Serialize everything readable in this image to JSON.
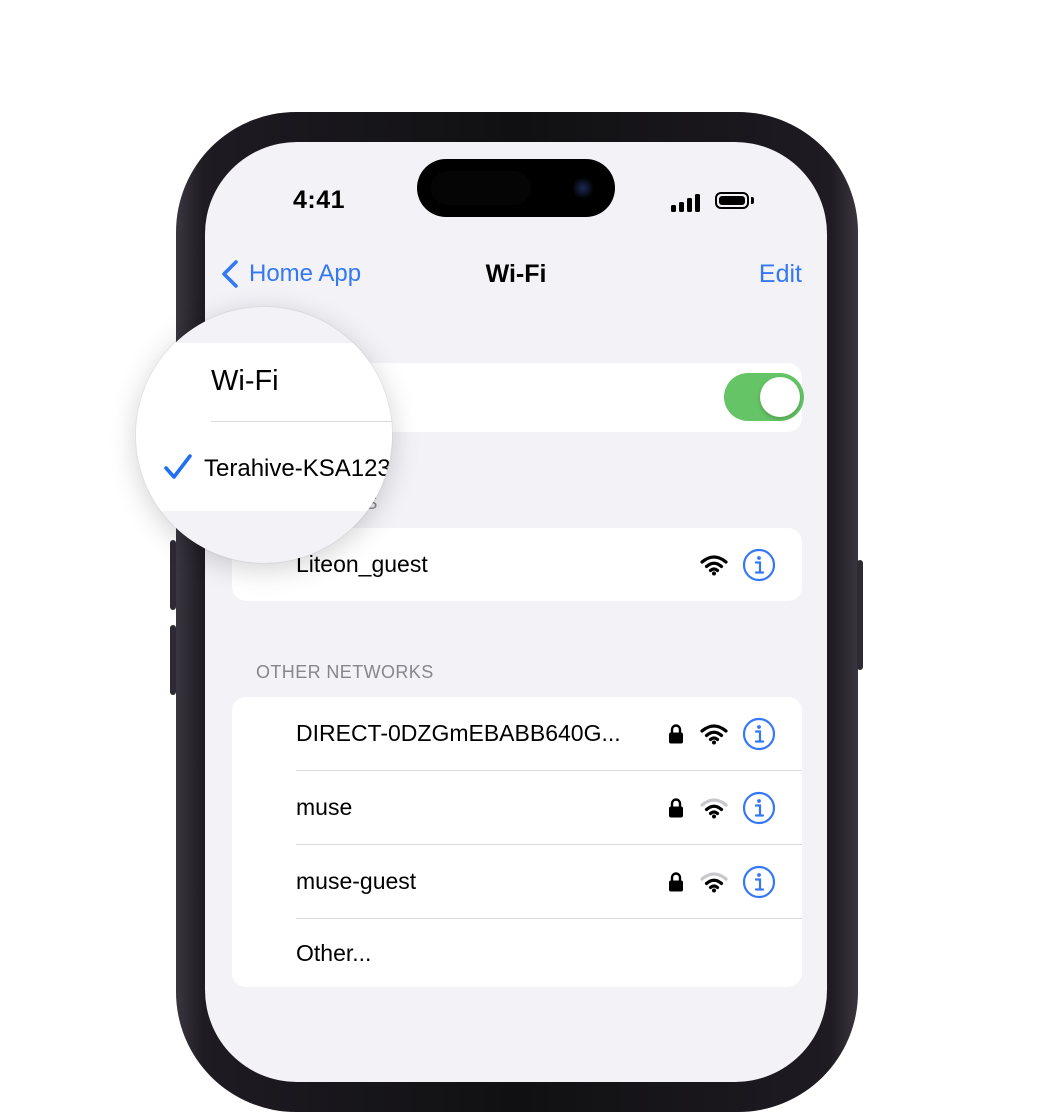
{
  "status_bar": {
    "time": "4:41",
    "signal_icon": "cellular-signal-icon",
    "battery_icon": "battery-full-icon"
  },
  "nav": {
    "back_label": "Home App",
    "title": "Wi-Fi",
    "edit_label": "Edit"
  },
  "wifi_toggle": {
    "label": "Wi-Fi",
    "on": true,
    "color": "#65c466"
  },
  "current_network": {
    "name": "Terahive-KSA123"
  },
  "my_networks": {
    "section_label_fragment": "KS",
    "items": [
      {
        "name": "Liteon_guest",
        "locked": false,
        "signal": "full"
      }
    ]
  },
  "other_networks": {
    "section_label": "OTHER NETWORKS",
    "items": [
      {
        "name": "DIRECT-0DZGmEBABB640G...",
        "locked": true,
        "signal": "full"
      },
      {
        "name": "muse",
        "locked": true,
        "signal": "weak"
      },
      {
        "name": "muse-guest",
        "locked": true,
        "signal": "weak"
      }
    ],
    "other_label": "Other..."
  },
  "colors": {
    "accent": "#3478f6",
    "background": "#f2f2f7",
    "toggle_on": "#65c466",
    "section_text": "#86868b"
  }
}
